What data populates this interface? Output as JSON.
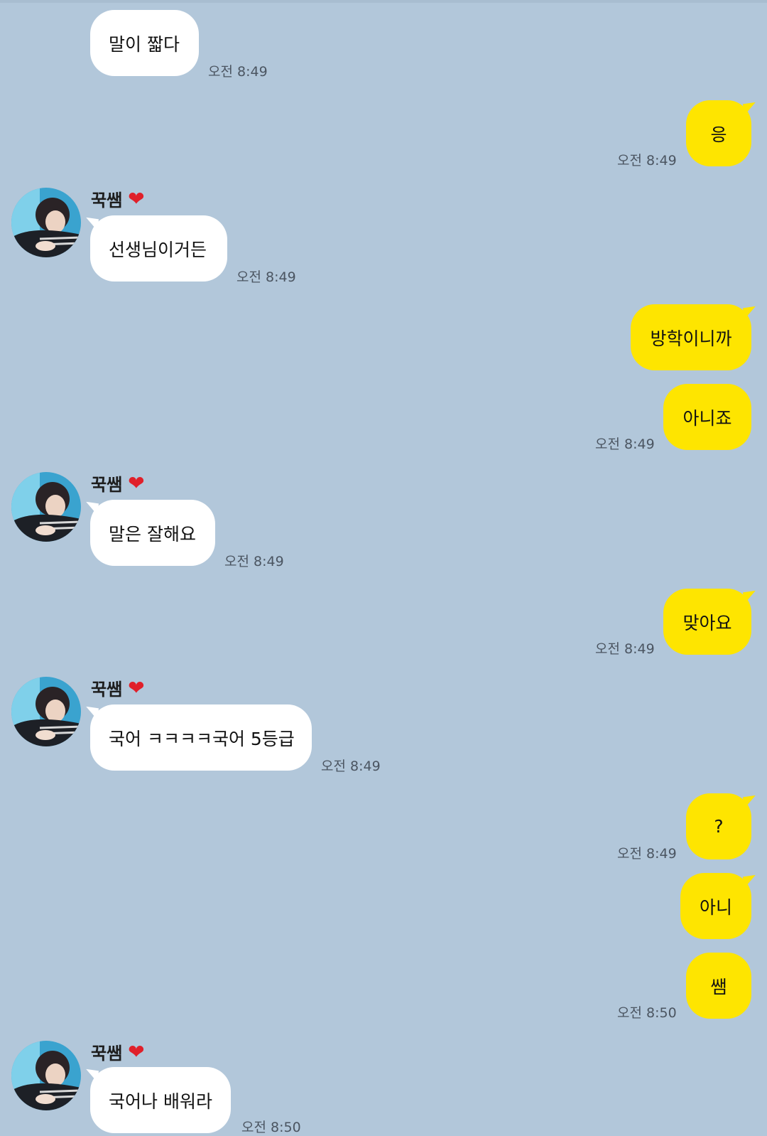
{
  "contact": {
    "name": "꾹쌤",
    "name_icon": "heart-icon"
  },
  "messages": [
    {
      "dir": "in",
      "text": "말이 짧다",
      "time": "오전 8:49"
    },
    {
      "dir": "out",
      "text": "응",
      "time": "오전 8:49"
    },
    {
      "dir": "in",
      "text": "선생님이거든",
      "time": "오전 8:49"
    },
    {
      "dir": "out",
      "text": "방학이니까",
      "time": ""
    },
    {
      "dir": "out",
      "text": "아니죠",
      "time": "오전 8:49"
    },
    {
      "dir": "in",
      "text": "말은 잘해요",
      "time": "오전 8:49"
    },
    {
      "dir": "out",
      "text": "맞아요",
      "time": "오전 8:49"
    },
    {
      "dir": "in",
      "text": "국어 ㅋㅋㅋㅋ국어 5등급",
      "time": "오전 8:49"
    },
    {
      "dir": "out",
      "text": "?",
      "time": "오전 8:49"
    },
    {
      "dir": "out",
      "text": "아니",
      "time": ""
    },
    {
      "dir": "out",
      "text": "쌤",
      "time": "오전 8:50"
    },
    {
      "dir": "in",
      "text": "국어나 배워라",
      "time": "오전 8:50"
    }
  ],
  "colors": {
    "background": "#b2c7da",
    "incoming_bubble": "#ffffff",
    "outgoing_bubble": "#fee500",
    "timestamp": "#4b5561"
  }
}
